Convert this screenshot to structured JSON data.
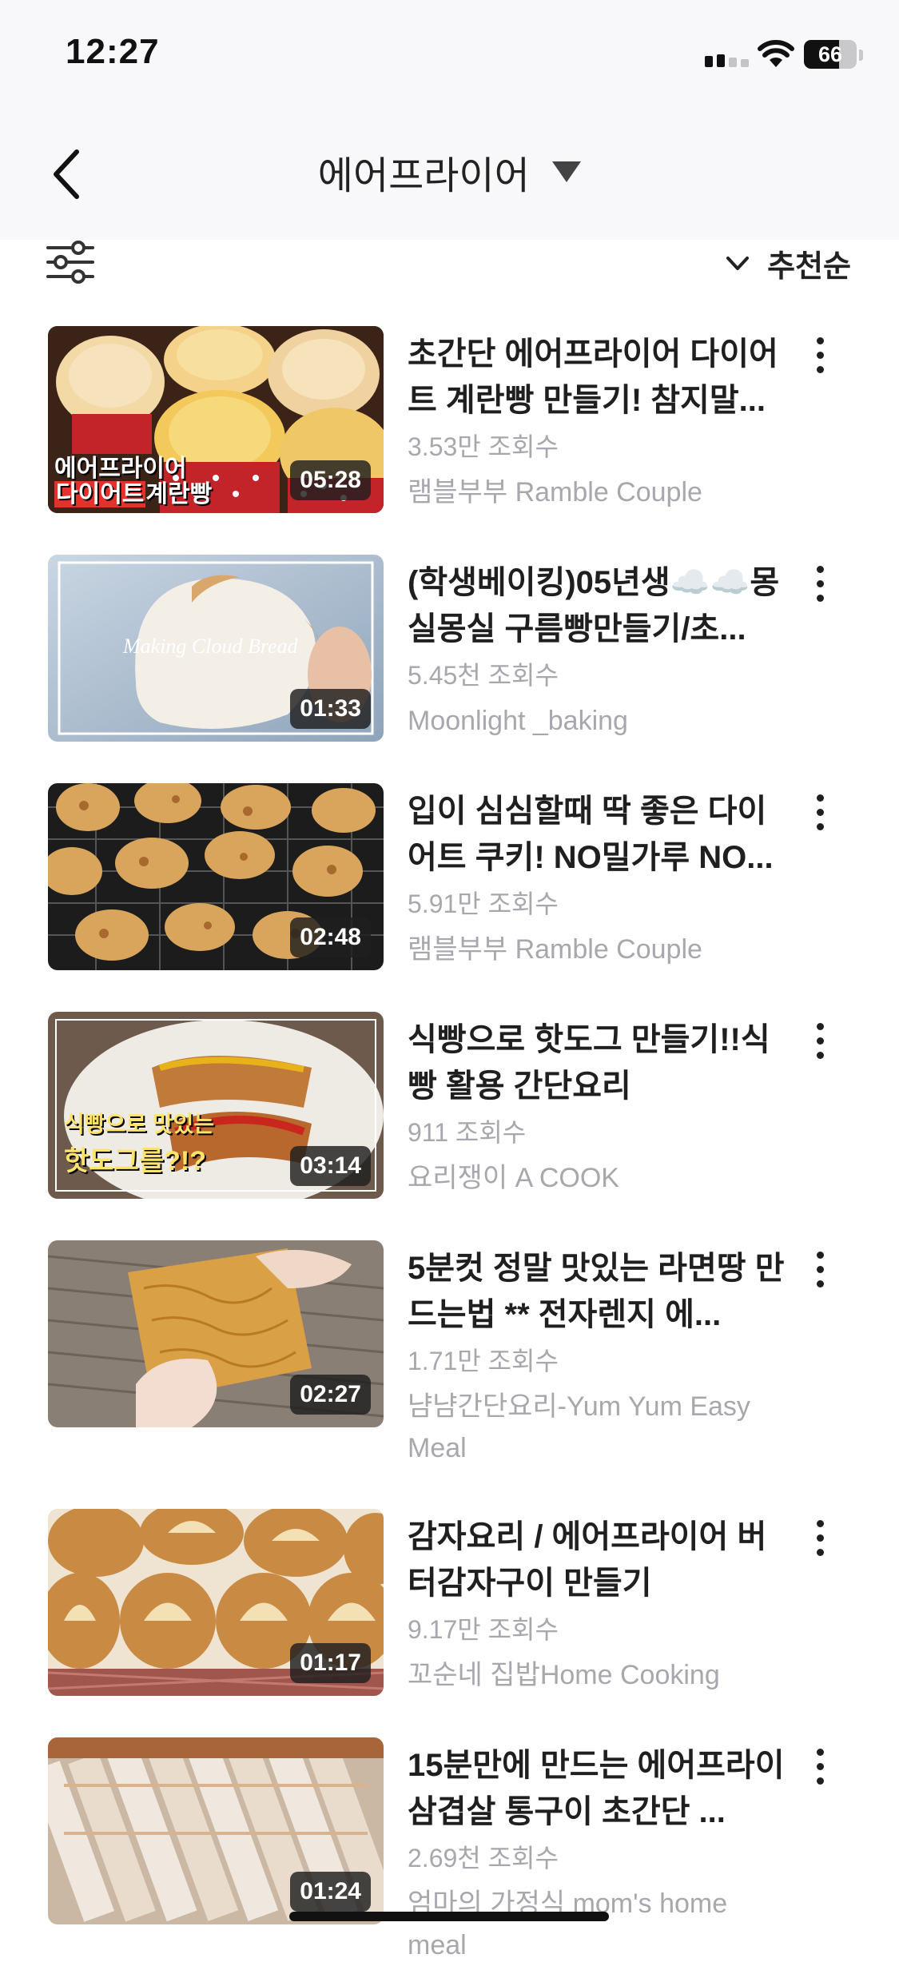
{
  "status_bar": {
    "time": "12:27",
    "battery": "66",
    "battery_level": 0.66
  },
  "header": {
    "title": "에어프라이어"
  },
  "toolbar": {
    "sort_label": "추천순"
  },
  "videos": [
    {
      "title": "초간단 에어프라이어 다이어트 계란빵 만들기! 참지말...",
      "views": "3.53만 조회수",
      "channel": "램블부부 Ramble Couple",
      "duration": "05:28",
      "overlay_line1": "에어프라이어",
      "overlay_line2a": "다이어트",
      "overlay_line2b": "계란빵"
    },
    {
      "title": "(학생베이킹)05년생☁️☁️몽실몽실 구름빵만들기/초...",
      "views": "5.45천 조회수",
      "channel": "Moonlight _baking",
      "duration": "01:33",
      "overlay": "Making Cloud Bread"
    },
    {
      "title": "입이 심심할때 딱 좋은 다이어트 쿠키! NO밀가루 NO...",
      "views": "5.91만 조회수",
      "channel": "램블부부 Ramble Couple",
      "duration": "02:48"
    },
    {
      "title": "식빵으로 핫도그 만들기!!식빵 활용 간단요리",
      "views": "911 조회수",
      "channel": "요리쟁이 A COOK",
      "duration": "03:14",
      "overlay_line1": "식빵으로 맛있는",
      "overlay_line2": "핫도그를?!?"
    },
    {
      "title": "5분컷 정말 맛있는 라면땅 만드는법 ** 전자렌지 에...",
      "views": "1.71만 조회수",
      "channel": "냠냠간단요리-Yum Yum Easy Meal",
      "duration": "02:27"
    },
    {
      "title": "감자요리 / 에어프라이어 버터감자구이 만들기",
      "views": "9.17만 조회수",
      "channel": "꼬순네 집밥Home Cooking",
      "duration": "01:17"
    },
    {
      "title": "15분만에 만드는 에어프라이 삼겹살 통구이 초간단 ...",
      "views": "2.69천 조회수",
      "channel": "엄마의 가정식 mom's home meal",
      "duration": "01:24"
    }
  ],
  "colors": {
    "text": "#1f1f1f",
    "meta": "#a7a7ad",
    "header_bg": "#f8f8fa",
    "accent_red": "#e3322b"
  }
}
